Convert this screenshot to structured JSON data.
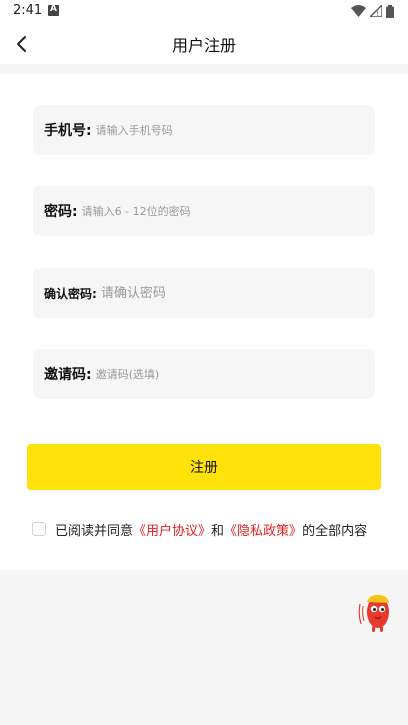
{
  "status": {
    "time": "2:41"
  },
  "header": {
    "title": "用户注册"
  },
  "form": {
    "phone": {
      "label": "手机号:",
      "placeholder": "请输入手机号码"
    },
    "password": {
      "label": "密码:",
      "placeholder": "请输入6 - 12位的密码"
    },
    "confirm": {
      "label": "确认密码:",
      "placeholder": "请确认密码"
    },
    "invite": {
      "label": "邀请码:",
      "placeholder": "邀请码(选填)"
    }
  },
  "submit_label": "注册",
  "agreement": {
    "prefix": "已阅读并同意",
    "user_agreement": "《用户协议》",
    "and": "和",
    "privacy_policy": "《隐私政策》",
    "suffix": "的全部内容"
  },
  "colors": {
    "accent": "#ffe20a",
    "link": "#e41f1f"
  }
}
